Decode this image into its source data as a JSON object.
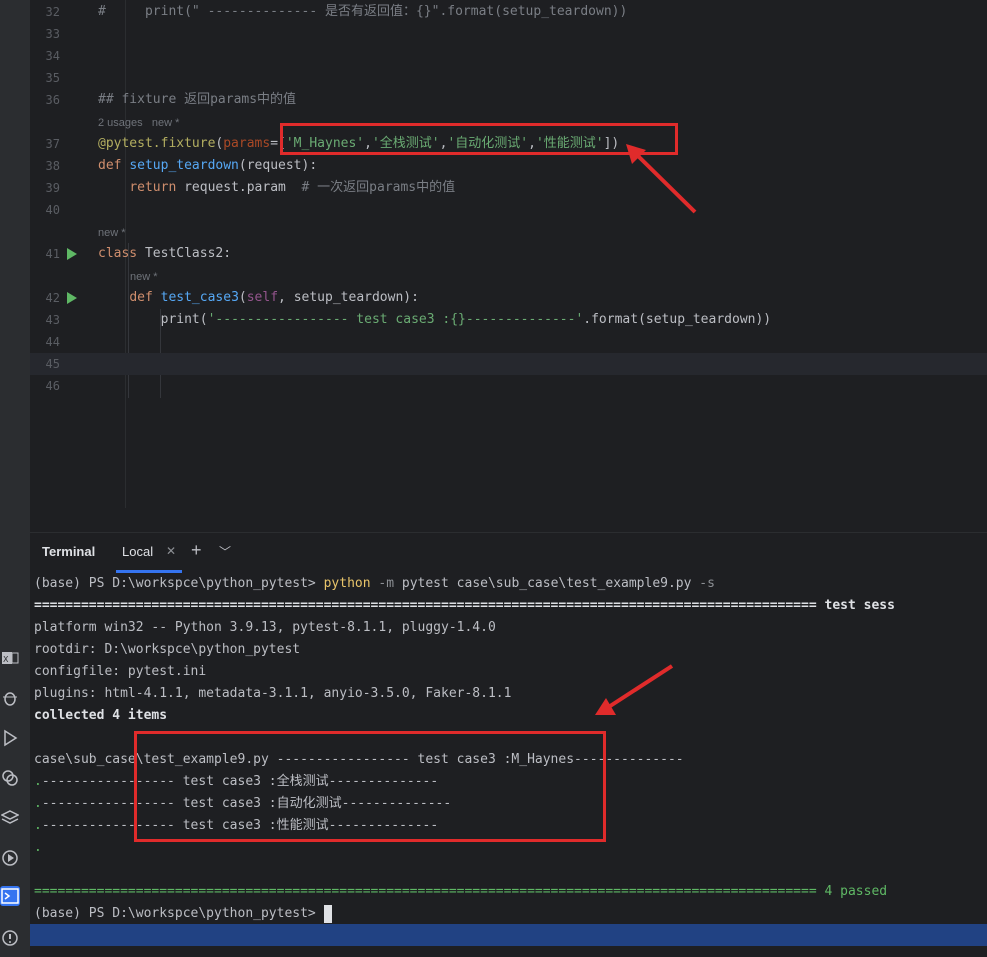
{
  "editor": {
    "lines": [
      {
        "num": "32",
        "tokens": [
          [
            "c-comment",
            "#     print(\" -------------- 是否有返回值：{}\".format(setup_teardown))"
          ]
        ]
      },
      {
        "num": "33",
        "tokens": []
      },
      {
        "num": "34",
        "tokens": []
      },
      {
        "num": "35",
        "tokens": []
      },
      {
        "num": "36",
        "tokens": [
          [
            "c-comment",
            "## fixture 返回params中的值"
          ]
        ]
      },
      {
        "num": "37",
        "tokens": [
          [
            "c-deco",
            "@pytest.fixture"
          ],
          [
            "c-text",
            "("
          ],
          [
            "c-param",
            "params"
          ],
          [
            "c-text",
            "=["
          ],
          [
            "c-str",
            "'M_Haynes'"
          ],
          [
            "c-text",
            ","
          ],
          [
            "c-str",
            "'全栈测试'"
          ],
          [
            "c-text",
            ","
          ],
          [
            "c-str",
            "'自动化测试'"
          ],
          [
            "c-text",
            ","
          ],
          [
            "c-str",
            "'性能测试'"
          ],
          [
            "c-text",
            "])"
          ]
        ]
      },
      {
        "num": "38",
        "tokens": [
          [
            "c-kw",
            "def "
          ],
          [
            "c-fn",
            "setup_teardown"
          ],
          [
            "c-text",
            "(request):"
          ]
        ]
      },
      {
        "num": "39",
        "tokens": [
          [
            "c-text",
            "    "
          ],
          [
            "c-kw",
            "return"
          ],
          [
            "c-text",
            " request.param  "
          ],
          [
            "c-comment",
            "# 一次返回params中的值"
          ]
        ]
      },
      {
        "num": "40",
        "tokens": []
      },
      {
        "num": "41",
        "tokens": [
          [
            "c-kw",
            "class "
          ],
          [
            "c-text",
            "TestClass2:"
          ]
        ]
      },
      {
        "num": "42",
        "tokens": [
          [
            "c-text",
            "    "
          ],
          [
            "c-kw",
            "def "
          ],
          [
            "c-fn",
            "test_case3"
          ],
          [
            "c-text",
            "("
          ],
          [
            "c-self",
            "self"
          ],
          [
            "c-text",
            ", setup_teardown):"
          ]
        ]
      },
      {
        "num": "43",
        "tokens": [
          [
            "c-text",
            "        "
          ],
          [
            "c-text",
            "print("
          ],
          [
            "c-str",
            "'----------------- test case3 :{}--------------'"
          ],
          [
            "c-text",
            ".format(setup_teardown))"
          ]
        ]
      },
      {
        "num": "44",
        "tokens": []
      },
      {
        "num": "45",
        "tokens": []
      },
      {
        "num": "46",
        "tokens": []
      }
    ],
    "hints": {
      "usages": "2 usages",
      "new1": "new *",
      "new2": "new *",
      "new3": "new *"
    }
  },
  "terminal": {
    "tab_title": "Terminal",
    "tab_local": "Local",
    "lines": [
      [
        [
          "t-text",
          "(base) PS D:\\workspce\\python_pytest> "
        ],
        [
          "t-cmd",
          "python"
        ],
        [
          "t-flag",
          " -m "
        ],
        [
          "t-text",
          "pytest case\\sub_case\\test_example9.py "
        ],
        [
          "t-flag",
          "-s"
        ]
      ],
      [
        [
          "t-bold",
          "==================================================================================================== test sess"
        ]
      ],
      [
        [
          "t-text",
          "platform win32 -- Python 3.9.13, pytest-8.1.1, pluggy-1.4.0"
        ]
      ],
      [
        [
          "t-text",
          "rootdir: D:\\workspce\\python_pytest"
        ]
      ],
      [
        [
          "t-text",
          "configfile: pytest.ini"
        ]
      ],
      [
        [
          "t-text",
          "plugins: html-4.1.1, metadata-3.1.1, anyio-3.5.0, Faker-8.1.1"
        ]
      ],
      [
        [
          "t-bold",
          "collected 4 items"
        ]
      ],
      [],
      [
        [
          "t-text",
          "case\\sub_case\\test_example9.py ----------------- test case3 :M_Haynes--------------"
        ]
      ],
      [
        [
          "t-dot",
          "."
        ],
        [
          "t-text",
          "----------------- test case3 :全栈测试--------------"
        ]
      ],
      [
        [
          "t-dot",
          "."
        ],
        [
          "t-text",
          "----------------- test case3 :自动化测试--------------"
        ]
      ],
      [
        [
          "t-dot",
          "."
        ],
        [
          "t-text",
          "----------------- test case3 :性能测试--------------"
        ]
      ],
      [
        [
          "t-dot",
          "."
        ]
      ],
      [],
      [
        [
          "t-green",
          "==================================================================================================== 4 passed"
        ]
      ],
      [
        [
          "t-text",
          "(base) PS D:\\workspce\\python_pytest> "
        ]
      ]
    ]
  }
}
